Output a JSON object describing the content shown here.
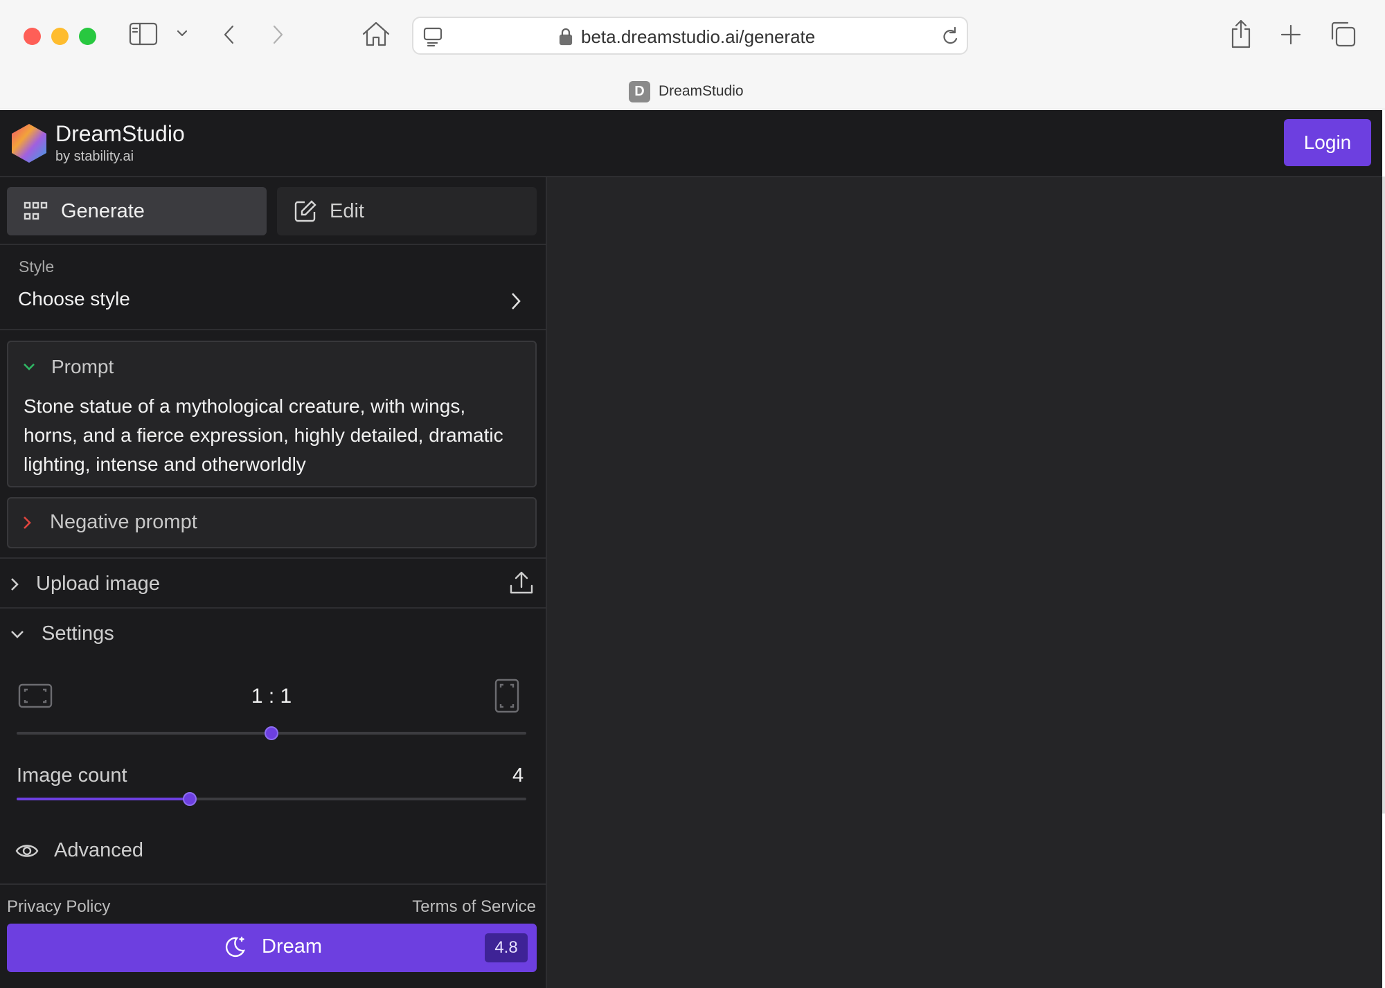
{
  "browser": {
    "url": "beta.dreamstudio.ai/generate",
    "tab_title": "DreamStudio",
    "favicon_letter": "D",
    "icons": [
      "sidebar-icon",
      "chevron-down-icon",
      "back-icon",
      "forward-icon",
      "home-icon",
      "reader-icon",
      "lock-icon",
      "reload-icon",
      "share-icon",
      "plus-icon",
      "tabs-icon"
    ]
  },
  "header": {
    "brand_title": "DreamStudio",
    "brand_subtitle": "by stability.ai",
    "login_label": "Login"
  },
  "tabs": {
    "generate_label": "Generate",
    "edit_label": "Edit"
  },
  "style": {
    "label": "Style",
    "value": "Choose style"
  },
  "prompt": {
    "label": "Prompt",
    "text": "Stone statue of a mythological creature, with wings, horns, and a fierce expression, highly detailed, dramatic lighting, intense and otherworldly"
  },
  "negative_prompt": {
    "label": "Negative prompt"
  },
  "upload": {
    "label": "Upload image"
  },
  "settings": {
    "label": "Settings",
    "aspect_ratio": "1 : 1",
    "aspect_slider_fraction": 0.5,
    "image_count_label": "Image count",
    "image_count": "4",
    "image_count_fraction": 0.34,
    "advanced_label": "Advanced"
  },
  "footer": {
    "privacy_label": "Privacy Policy",
    "terms_label": "Terms of Service",
    "dream_label": "Dream",
    "dream_cost": "4.8"
  },
  "colors": {
    "accent": "#6d3fe0",
    "background": "#1b1b1d",
    "canvas": "#252527"
  }
}
